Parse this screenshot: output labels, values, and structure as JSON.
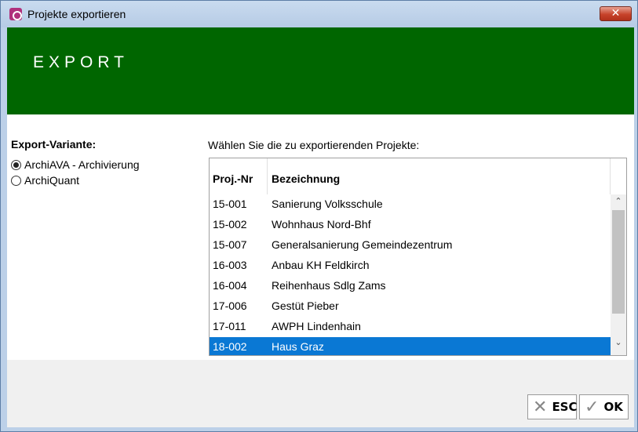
{
  "window": {
    "title": "Projekte exportieren",
    "close_label": "✕"
  },
  "banner": {
    "title": "EXPORT",
    "color": "#006600"
  },
  "export_variant": {
    "label": "Export-Variante:",
    "options": [
      {
        "label": "ArchiAVA - Archivierung",
        "checked": true
      },
      {
        "label": "ArchiQuant",
        "checked": false
      }
    ]
  },
  "projects": {
    "caption": "Wählen Sie die zu exportierenden Projekte:",
    "columns": [
      "Proj.-Nr",
      "Bezeichnung"
    ],
    "rows": [
      {
        "nr": "15-001",
        "name": "Sanierung Volksschule"
      },
      {
        "nr": "15-002",
        "name": "Wohnhaus Nord-Bhf"
      },
      {
        "nr": "15-007",
        "name": "Generalsanierung Gemeindezentrum"
      },
      {
        "nr": "16-003",
        "name": "Anbau KH Feldkirch"
      },
      {
        "nr": "16-004",
        "name": "Reihenhaus Sdlg Zams"
      },
      {
        "nr": "17-006",
        "name": "Gestüt Pieber"
      },
      {
        "nr": "17-011",
        "name": "AWPH Lindenhain"
      },
      {
        "nr": "18-002",
        "name": "Haus Graz"
      }
    ],
    "selected_index": 7
  },
  "buttons": {
    "esc_label": "ESC",
    "esc_glyph": "✕",
    "ok_label": "OK",
    "ok_glyph": "✓"
  }
}
